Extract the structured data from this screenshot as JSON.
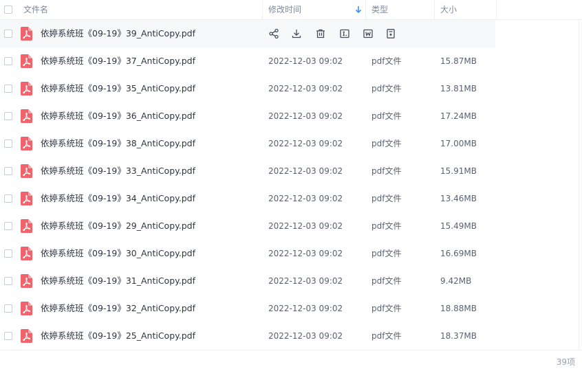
{
  "header": {
    "name_label": "文件名",
    "modified_label": "修改时间",
    "type_label": "类型",
    "size_label": "大小"
  },
  "files": [
    {
      "name": "依婷系统班《09-19》39_AntiCopy.pdf",
      "date": "",
      "type": "",
      "size": ""
    },
    {
      "name": "依婷系统班《09-19》37_AntiCopy.pdf",
      "date": "2022-12-03 09:02",
      "type": "pdf文件",
      "size": "15.87MB"
    },
    {
      "name": "依婷系统班《09-19》35_AntiCopy.pdf",
      "date": "2022-12-03 09:02",
      "type": "pdf文件",
      "size": "13.81MB"
    },
    {
      "name": "依婷系统班《09-19》36_AntiCopy.pdf",
      "date": "2022-12-03 09:02",
      "type": "pdf文件",
      "size": "17.24MB"
    },
    {
      "name": "依婷系统班《09-19》38_AntiCopy.pdf",
      "date": "2022-12-03 09:02",
      "type": "pdf文件",
      "size": "17.00MB"
    },
    {
      "name": "依婷系统班《09-19》33_AntiCopy.pdf",
      "date": "2022-12-03 09:02",
      "type": "pdf文件",
      "size": "15.91MB"
    },
    {
      "name": "依婷系统班《09-19》34_AntiCopy.pdf",
      "date": "2022-12-03 09:02",
      "type": "pdf文件",
      "size": "13.46MB"
    },
    {
      "name": "依婷系统班《09-19》29_AntiCopy.pdf",
      "date": "2022-12-03 09:02",
      "type": "pdf文件",
      "size": "15.49MB"
    },
    {
      "name": "依婷系统班《09-19》30_AntiCopy.pdf",
      "date": "2022-12-03 09:02",
      "type": "pdf文件",
      "size": "16.69MB"
    },
    {
      "name": "依婷系统班《09-19》31_AntiCopy.pdf",
      "date": "2022-12-03 09:02",
      "type": "pdf文件",
      "size": "9.42MB"
    },
    {
      "name": "依婷系统班《09-19》32_AntiCopy.pdf",
      "date": "2022-12-03 09:02",
      "type": "pdf文件",
      "size": "18.88MB"
    },
    {
      "name": "依婷系统班《09-19》25_AntiCopy.pdf",
      "date": "2022-12-03 09:02",
      "type": "pdf文件",
      "size": "18.37MB"
    }
  ],
  "hover_actions": [
    "share-icon",
    "download-icon",
    "delete-icon",
    "rename-icon",
    "word-convert-icon",
    "more-file-icon"
  ],
  "footer": {
    "count": "39项"
  },
  "colors": {
    "pdf_icon": "#f0636b",
    "sort_arrow": "#3b8ff5",
    "hover_row": "#f7f8fa"
  }
}
